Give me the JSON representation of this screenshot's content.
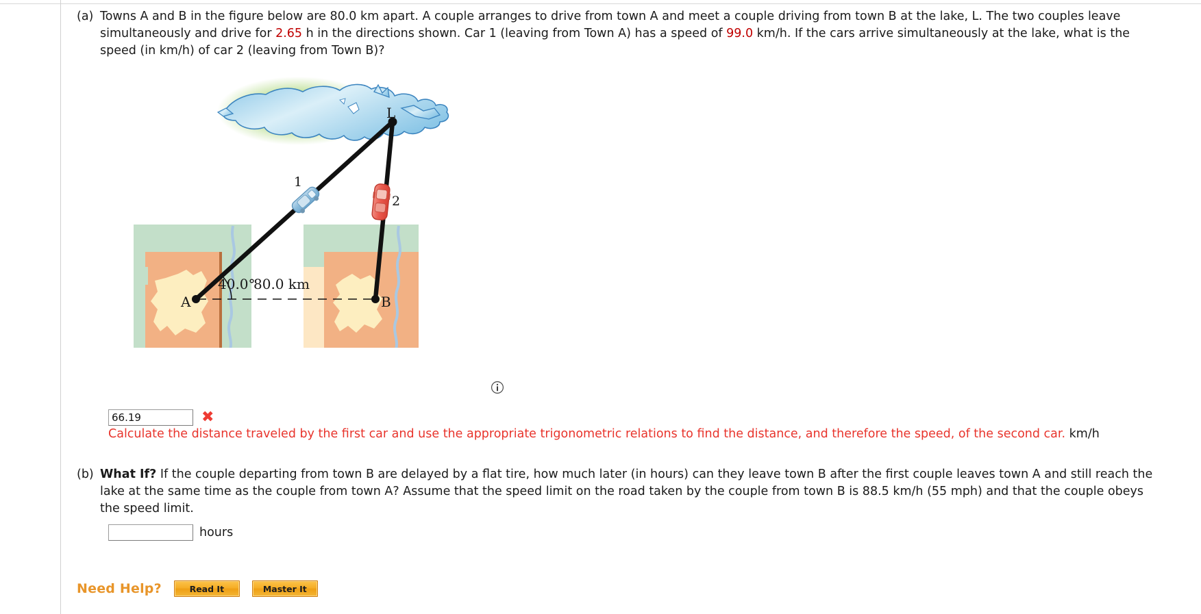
{
  "problem": {
    "part_a": {
      "label": "(a)",
      "text_before_1": "Towns A and B in the figure below are 80.0 km apart. A couple arranges to drive from town A and meet a couple driving from town B at the lake, L. The two couples leave simultaneously and drive for ",
      "value_time": "2.65",
      "text_mid": " h in the directions shown. Car 1 (leaving from Town A) has a speed of ",
      "value_speed": "99.0",
      "text_after": " km/h. If the cars arrive simultaneously at the lake, what is the speed (in km/h) of car 2 (leaving from Town B)?",
      "answer_value": "66.19",
      "answer_status": "incorrect",
      "wrong_mark": "✖",
      "feedback": "Calculate the distance traveled by the first car and use the appropriate trigonometric relations to find the distance, and therefore the speed, of the second car.",
      "feedback_unit": "km/h"
    },
    "part_b": {
      "label": "(b)",
      "whatif": "What If?",
      "text": " If the couple departing from town B are delayed by a flat tire, how much later (in hours) can they leave town B after the first couple leaves town A and still reach the lake at the same time as the couple from town A? Assume that the speed limit on the road taken by the couple from town B is 88.5 km/h (55 mph) and that the couple obeys the speed limit.",
      "answer_value": "",
      "answer_placeholder": "",
      "unit": "hours"
    }
  },
  "figure": {
    "point_a_label": "A",
    "point_b_label": "B",
    "lake_label": "L",
    "car1_label": "1",
    "car2_label": "2",
    "angle_label": "40.0°",
    "distance_label": "80.0 km",
    "info_icon": "info-icon",
    "colors": {
      "lake_fill": "#a8d4ee",
      "lake_stroke": "#3b84bf",
      "lake_glow": "#b9dd8f",
      "map_green": "#c3dfc9",
      "map_orange": "#f2b184",
      "map_cream": "#fdeec0",
      "map_pale": "#fde7c4",
      "river": "#a9c8e2",
      "road": "#111111",
      "car1": "#8fbedd",
      "car2": "#ea5a4e"
    }
  },
  "help": {
    "label": "Need Help?",
    "read_it": "Read It",
    "master_it": "Master It"
  }
}
